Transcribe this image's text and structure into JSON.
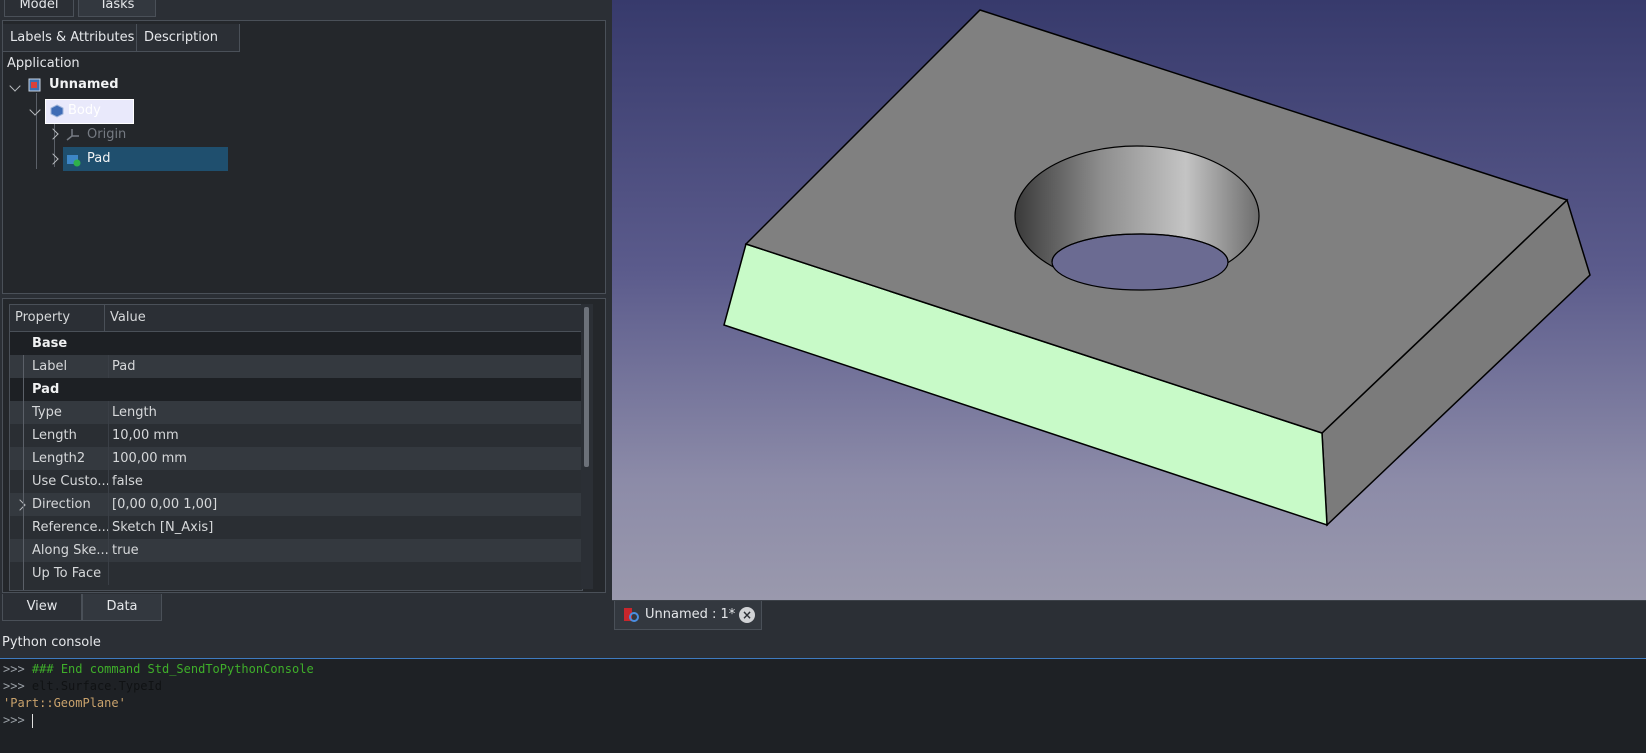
{
  "combo_view": {
    "tabs": [
      "Model",
      "Tasks"
    ],
    "tree": {
      "columns": [
        "Labels & Attributes",
        "Description"
      ],
      "root_label": "Application",
      "items": [
        {
          "label": "Unnamed",
          "icon": "document-icon",
          "expanded": true
        },
        {
          "label": "Body",
          "icon": "body-icon",
          "expanded": true,
          "editing": true
        },
        {
          "label": "Origin",
          "icon": "origin-icon",
          "expanded": false
        },
        {
          "label": "Pad",
          "icon": "pad-icon",
          "expanded": false,
          "selected": true
        }
      ]
    },
    "property_view": {
      "columns": [
        "Property",
        "Value"
      ],
      "rows": [
        {
          "name": "Base",
          "value": "",
          "group": true
        },
        {
          "name": "Label",
          "value": "Pad"
        },
        {
          "name": "Pad",
          "value": "",
          "group": true
        },
        {
          "name": "Type",
          "value": "Length"
        },
        {
          "name": "Length",
          "value": "10,00 mm"
        },
        {
          "name": "Length2",
          "value": "100,00 mm"
        },
        {
          "name": "Use Custo...",
          "value": "false"
        },
        {
          "name": "Direction",
          "value": "[0,00 0,00 1,00]",
          "expandable": true
        },
        {
          "name": "Reference...",
          "value": "Sketch [N_Axis]"
        },
        {
          "name": "Along Ske...",
          "value": "true"
        },
        {
          "name": "Up To Face",
          "value": ""
        }
      ]
    },
    "bottom_tabs": [
      "View",
      "Data"
    ]
  },
  "document_tab": {
    "label": "Unnamed : 1*",
    "icon": "freecad-doc-icon",
    "close_icon": "close-icon",
    "close_glyph": "×"
  },
  "python_console": {
    "title": "Python console",
    "lines": [
      {
        "prompt": ">>>",
        "text": "### End command Std_SendToPythonConsole",
        "kind": "comment"
      },
      {
        "prompt": ">>>",
        "text": "elt.Surface.TypeId",
        "kind": "code"
      },
      {
        "prompt": "",
        "text": "'Part::GeomPlane'",
        "kind": "output"
      },
      {
        "prompt": ">>>",
        "text": "",
        "kind": "input"
      }
    ]
  },
  "colors": {
    "selection_blue": "#1f4f6e",
    "highlight_green": "#c8fac8",
    "model_gray": "#808080",
    "console_comment": "#3fae2a"
  }
}
